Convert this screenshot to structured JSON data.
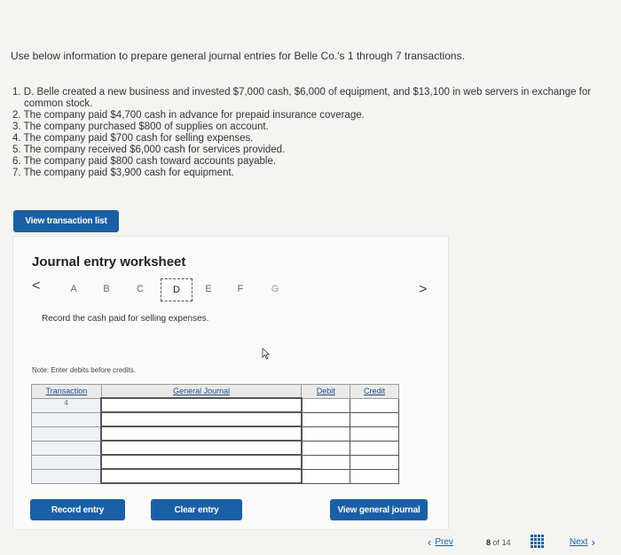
{
  "intro": "Use below information to prepare general journal entries for Belle Co.'s 1 through 7 transactions.",
  "transactions": [
    {
      "num": "1.",
      "text": "D. Belle created a new business and invested $7,000 cash, $6,000 of equipment, and $13,100 in web servers in exchange for",
      "cont": "common stock."
    },
    {
      "num": "2.",
      "text": "The company paid $4,700 cash in advance for prepaid insurance coverage."
    },
    {
      "num": "3.",
      "text": "The company purchased $800 of supplies on account."
    },
    {
      "num": "4.",
      "text": "The company paid $700 cash for selling expenses."
    },
    {
      "num": "5.",
      "text": "The company received $6,000 cash for services provided."
    },
    {
      "num": "6.",
      "text": "The company paid $800 cash toward accounts payable."
    },
    {
      "num": "7.",
      "text": "The company paid $3,900 cash for equipment."
    }
  ],
  "buttons": {
    "view_transaction_list": "View transaction list",
    "record_entry": "Record entry",
    "clear_entry": "Clear entry",
    "view_general_journal": "View general journal"
  },
  "worksheet": {
    "title": "Journal entry worksheet",
    "tabs": [
      "A",
      "B",
      "C",
      "D",
      "E",
      "F",
      "G"
    ],
    "active_tab": "D",
    "prev_arrow": "<",
    "next_arrow": ">",
    "prompt": "Record the cash paid for selling expenses.",
    "note": "Note: Enter debits before credits."
  },
  "journal": {
    "headers": {
      "transaction": "Transaction",
      "general_journal": "General Journal",
      "debit": "Debit",
      "credit": "Credit"
    },
    "rows": [
      {
        "transaction": "4"
      },
      {
        "transaction": ""
      },
      {
        "transaction": ""
      },
      {
        "transaction": ""
      },
      {
        "transaction": ""
      },
      {
        "transaction": ""
      }
    ]
  },
  "pagination": {
    "prev": "Prev",
    "current": "8",
    "of": "of",
    "total": "14",
    "next": "Next"
  },
  "colors": {
    "accent": "#1a5fa6",
    "background": "#f4f4f2"
  }
}
